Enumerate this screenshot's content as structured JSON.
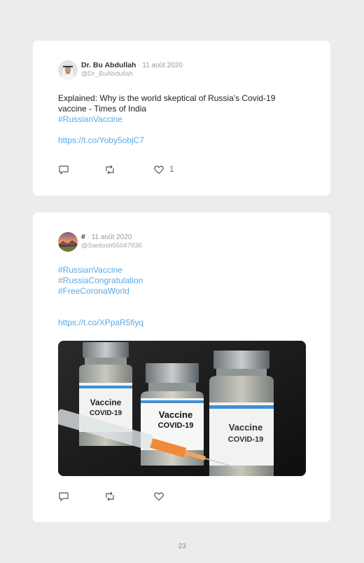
{
  "tweets": [
    {
      "name": "Dr. Bu Abdullah",
      "date": " · 11 août 2020",
      "handle": "@Dr_BuAbdullah",
      "text_lines": [
        "Explained: Why is the world skeptical of Russia's Covid-19",
        "vaccine - Times of India"
      ],
      "hashtags": [
        "#RussianVaccine"
      ],
      "link": "https://t.co/Yoby5objC7",
      "likes": "1",
      "avatar": "man-in-white-headdress"
    },
    {
      "name": "#",
      "date": " · 11 août 2020",
      "handle": "@Santosh55047936",
      "hashtags": [
        "#RussianVaccine",
        "#RussiaCongratulation",
        "#FreeCoronaWorld"
      ],
      "link": "https://t.co/XPpaR5fiyq",
      "media": {
        "description_icon": "vaccine-vials-photo",
        "vial_labels": [
          "Vaccine",
          "COVID-19"
        ]
      },
      "avatar": "sunset-landscape"
    }
  ],
  "page_number": "23",
  "colors": {
    "hashtag": "#5aa9e6",
    "background": "#ececeb",
    "card": "#ffffff"
  }
}
